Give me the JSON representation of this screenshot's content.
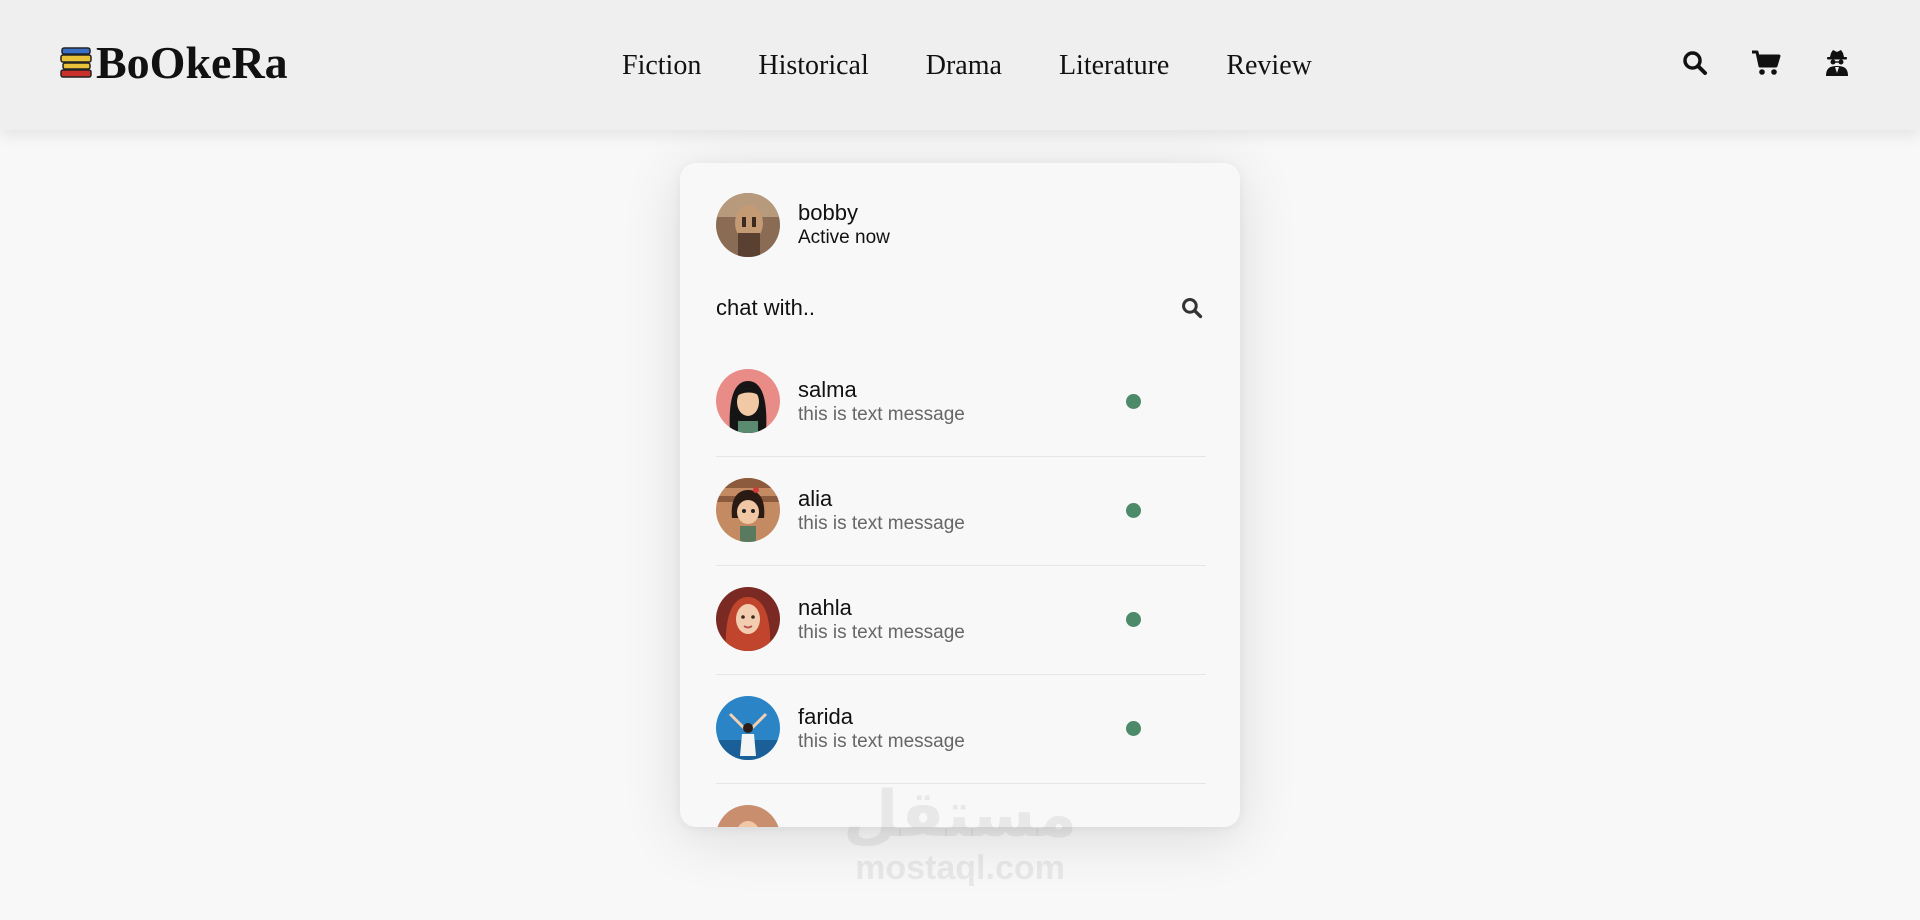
{
  "brand": {
    "name": "BoOkeRa"
  },
  "nav": {
    "items": [
      {
        "label": "Fiction"
      },
      {
        "label": "Historical"
      },
      {
        "label": "Drama"
      },
      {
        "label": "Literature"
      },
      {
        "label": "Review"
      }
    ]
  },
  "header_icons": [
    "search-icon",
    "cart-icon",
    "user-spy-icon"
  ],
  "chat": {
    "current_user": {
      "name": "bobby",
      "status": "Active now"
    },
    "search": {
      "placeholder": "chat with.."
    },
    "contacts": [
      {
        "name": "salma",
        "message": "this is text message",
        "status_color": "#4d8a6a"
      },
      {
        "name": "alia",
        "message": "this is text message",
        "status_color": "#4d8a6a"
      },
      {
        "name": "nahla",
        "message": "this is text message",
        "status_color": "#4d8a6a"
      },
      {
        "name": "farida",
        "message": "this is text message",
        "status_color": "#4d8a6a"
      }
    ]
  },
  "watermark": {
    "arabic": "مستقل",
    "latin": "mostaql.com"
  },
  "colors": {
    "header_bg": "#efefef",
    "page_bg": "#f8f8f8",
    "online_dot": "#4d8a6a"
  }
}
